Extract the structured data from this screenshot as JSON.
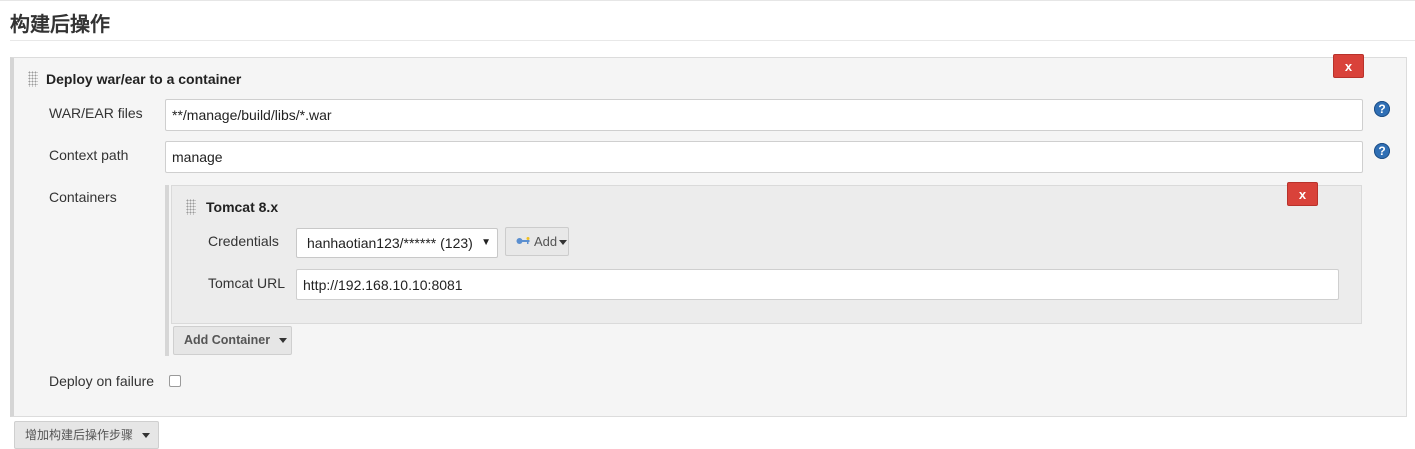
{
  "section": {
    "title": "构建后操作",
    "add_step_label": "增加构建后操作步骤"
  },
  "deploy": {
    "title": "Deploy war/ear to a container",
    "delete_label": "x",
    "war_files_label": "WAR/EAR files",
    "war_files_value": "**/manage/build/libs/*.war",
    "context_path_label": "Context path",
    "context_path_value": "manage",
    "containers_label": "Containers",
    "deploy_on_failure_label": "Deploy on failure",
    "deploy_on_failure_checked": false,
    "help_glyph": "?"
  },
  "tomcat": {
    "title": "Tomcat 8.x",
    "delete_label": "x",
    "credentials_label": "Credentials",
    "credentials_value": "hanhaotian123/****** (123)",
    "add_label": "Add",
    "url_label": "Tomcat URL",
    "url_value": "http://192.168.10.10:8081"
  },
  "add_container_label": "Add Container",
  "colors": {
    "delete_red": "#d9423a",
    "help_blue": "#2f6fb5",
    "panel_bg": "#f5f5f5"
  }
}
